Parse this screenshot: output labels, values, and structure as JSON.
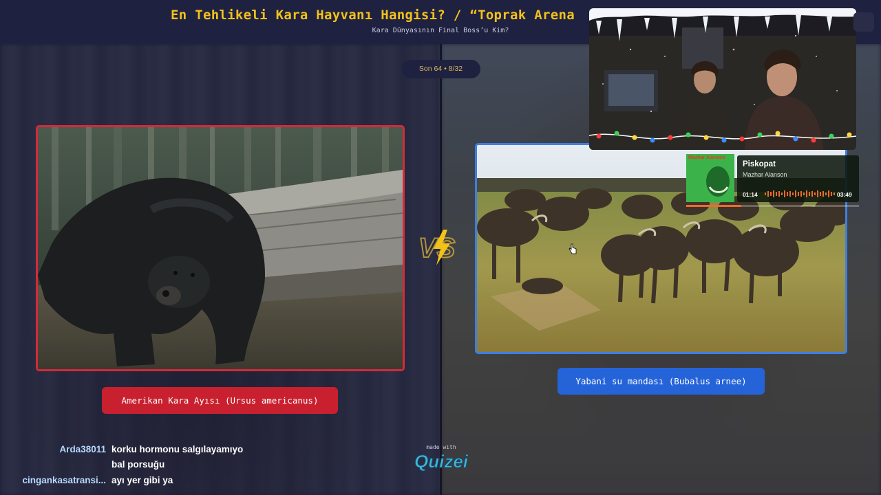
{
  "header": {
    "title": "En Tehlikeli Kara Hayvanı Hangisi? / “Toprak Arena",
    "subtitle": "Kara Dünyasının Final Boss’u Kim?"
  },
  "round": {
    "label": "Son 64 • 8/32"
  },
  "options": [
    {
      "label": "Amerikan Kara Ayısı (Ursus americanus)",
      "accent": "#d42a3a"
    },
    {
      "label": "Yabani su mandası (Bubalus arnee)",
      "accent": "#2563d9"
    }
  ],
  "vs_icon": "vs-lightning-icon",
  "music": {
    "album_text": "Mazhar Alanson",
    "title": "Piskopat",
    "artist": "Mazhar Alanson",
    "elapsed": "01:14",
    "duration": "03:49",
    "progress": 0.32,
    "accent": "#f06a2a"
  },
  "webcam": {
    "overlay": "festive-lights-snow"
  },
  "chat": [
    {
      "user": "Arda38011",
      "message": "korku hormonu salgılayamıyo"
    },
    {
      "user": "",
      "message": "bal porsuğu"
    },
    {
      "user": "cingankasatransi...",
      "message": "ayı yer gibi ya"
    }
  ],
  "branding": {
    "made_with": "made with",
    "logo": "Quizei"
  },
  "colors": {
    "title": "#f2c21a",
    "header_bg": "#1f2140"
  }
}
